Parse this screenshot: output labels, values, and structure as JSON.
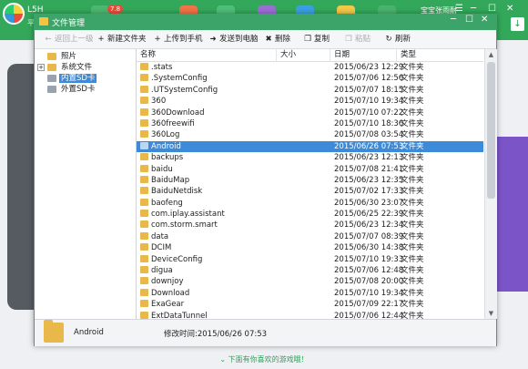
{
  "app": {
    "name": "L5H",
    "sub": "平",
    "badge": "7.8",
    "right_title": "宝宝张雨耐",
    "controls": [
      "☰",
      "─",
      "☐",
      "✕"
    ],
    "download_icon": "download-icon",
    "footer": "下面有你喜欢的游戏哦！",
    "colors": {
      "brand": "#33a85a",
      "selection": "#3c8ad8",
      "folder": "#e8b84a"
    }
  },
  "dialog": {
    "title": "文件管理",
    "controls": {
      "minimize": "─",
      "maximize": "☐",
      "close": "✕"
    },
    "toolbar": [
      {
        "icon": "←",
        "label": "返回上一级",
        "disabled": true
      },
      {
        "icon": "+",
        "label": "新建文件夹",
        "disabled": false
      },
      {
        "icon": "+",
        "label": "上传到手机",
        "disabled": false
      },
      {
        "icon": "➜",
        "label": "发送到电脑",
        "disabled": false
      },
      {
        "icon": "✖",
        "label": "删除",
        "disabled": false
      },
      {
        "icon": "❐",
        "label": "复制",
        "disabled": false
      },
      {
        "icon": "❒",
        "label": "粘贴",
        "disabled": true
      },
      {
        "icon": "↻",
        "label": "刷新",
        "disabled": false
      }
    ],
    "tree": [
      {
        "label": "照片",
        "expander": "",
        "selected": false
      },
      {
        "label": "系统文件",
        "expander": "+",
        "selected": false
      },
      {
        "label": "内置SD卡",
        "expander": "",
        "selected": true
      },
      {
        "label": "外置SD卡",
        "expander": "",
        "selected": false
      }
    ],
    "columns": {
      "name": "名称",
      "size": "大小",
      "date": "日期",
      "type": "类型"
    },
    "rows": [
      {
        "name": ".stats",
        "date": "2015/06/23 12:29",
        "type": "文件夹"
      },
      {
        "name": ".SystemConfig",
        "date": "2015/07/06 12:56",
        "type": "文件夹"
      },
      {
        "name": ".UTSystemConfig",
        "date": "2015/07/07 18:15",
        "type": "文件夹"
      },
      {
        "name": "360",
        "date": "2015/07/10 19:34",
        "type": "文件夹"
      },
      {
        "name": "360Download",
        "date": "2015/07/10 07:22",
        "type": "文件夹"
      },
      {
        "name": "360freewifi",
        "date": "2015/07/10 18:36",
        "type": "文件夹"
      },
      {
        "name": "360Log",
        "date": "2015/07/08 03:54",
        "type": "文件夹"
      },
      {
        "name": "Android",
        "date": "2015/06/26 07:53",
        "type": "文件夹",
        "selected": true
      },
      {
        "name": "backups",
        "date": "2015/06/23 12:13",
        "type": "文件夹"
      },
      {
        "name": "baidu",
        "date": "2015/07/08 21:41",
        "type": "文件夹"
      },
      {
        "name": "BaiduMap",
        "date": "2015/06/23 12:35",
        "type": "文件夹"
      },
      {
        "name": "BaiduNetdisk",
        "date": "2015/07/02 17:33",
        "type": "文件夹"
      },
      {
        "name": "baofeng",
        "date": "2015/06/30 23:07",
        "type": "文件夹"
      },
      {
        "name": "com.iplay.assistant",
        "date": "2015/06/25 22:39",
        "type": "文件夹"
      },
      {
        "name": "com.storm.smart",
        "date": "2015/06/23 12:34",
        "type": "文件夹"
      },
      {
        "name": "data",
        "date": "2015/07/07 08:39",
        "type": "文件夹"
      },
      {
        "name": "DCIM",
        "date": "2015/06/30 14:38",
        "type": "文件夹"
      },
      {
        "name": "DeviceConfig",
        "date": "2015/07/10 19:33",
        "type": "文件夹"
      },
      {
        "name": "digua",
        "date": "2015/07/06 12:48",
        "type": "文件夹"
      },
      {
        "name": "downjoy",
        "date": "2015/07/08 20:00",
        "type": "文件夹"
      },
      {
        "name": "Download",
        "date": "2015/07/10 19:34",
        "type": "文件夹"
      },
      {
        "name": "ExaGear",
        "date": "2015/07/09 22:17",
        "type": "文件夹"
      },
      {
        "name": "ExtDataTunnel",
        "date": "2015/07/06 12:44",
        "type": "文件夹"
      }
    ],
    "detail": {
      "name": "Android",
      "modified": "修改时间:2015/06/26 07:53"
    }
  }
}
